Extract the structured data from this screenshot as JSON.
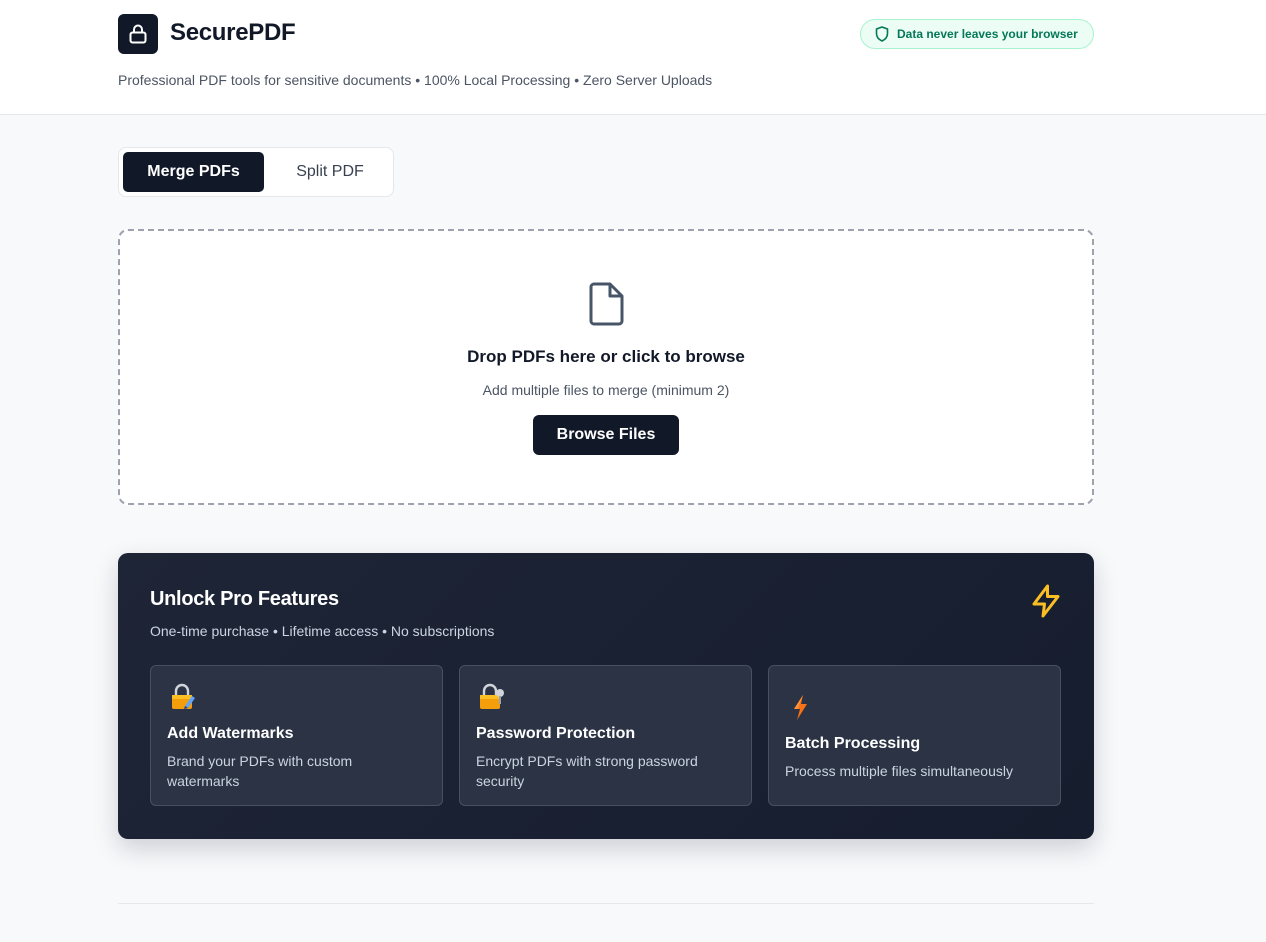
{
  "header": {
    "app_title": "SecurePDF",
    "tagline": "Professional PDF tools for sensitive documents • 100% Local Processing • Zero Server Uploads",
    "privacy_badge": "Data never leaves your browser",
    "logo_icon": "lock-icon"
  },
  "tabs": [
    {
      "label": "Merge PDFs",
      "active": true
    },
    {
      "label": "Split PDF",
      "active": false
    }
  ],
  "dropzone": {
    "icon": "file-icon",
    "title": "Drop PDFs here or click to browse",
    "subtitle": "Add multiple files to merge (minimum 2)",
    "button_label": "Browse Files"
  },
  "pro": {
    "title": "Unlock Pro Features",
    "subtitle": "One-time purchase • Lifetime access • No subscriptions",
    "icon": "lightning-bolt-icon",
    "features": [
      {
        "icon": "locked-with-pen-icon",
        "title": "Add Watermarks",
        "description": "Brand your PDFs with custom watermarks"
      },
      {
        "icon": "locked-with-key-icon",
        "title": "Password Protection",
        "description": "Encrypt PDFs with strong password security"
      },
      {
        "icon": "lightning-bolt-icon",
        "title": "Batch Processing",
        "description": "Process multiple files simultaneously"
      }
    ]
  },
  "colors": {
    "primary": "#111827",
    "badge_green": "#047857",
    "pro_bg": "#1e2537",
    "accent_yellow": "#fbbf24"
  }
}
